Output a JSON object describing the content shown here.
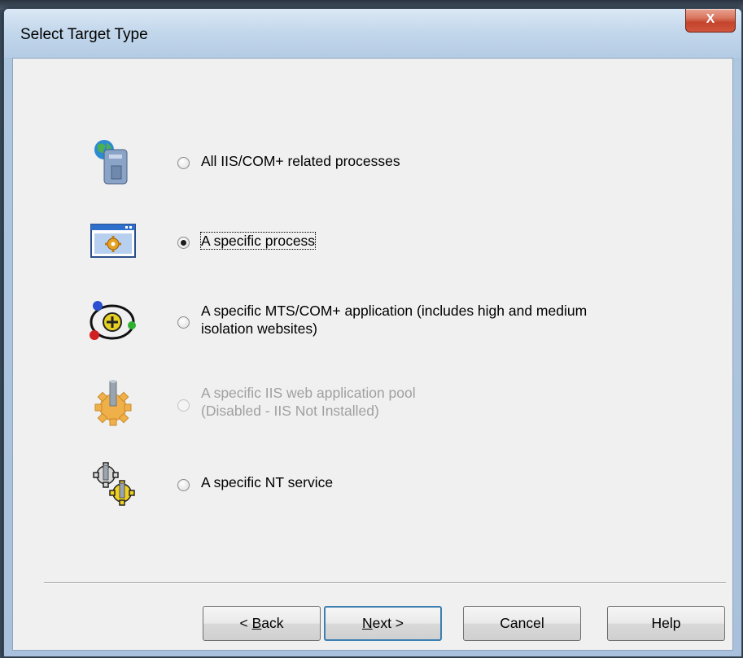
{
  "window": {
    "title": "Select Target Type",
    "close_glyph": "X"
  },
  "options": [
    {
      "label_line1": "All IIS/COM+ related processes",
      "label_line2": "",
      "icon": "iis-server-icon",
      "selected": false,
      "enabled": true
    },
    {
      "label_line1": "A specific process",
      "label_line2": "",
      "icon": "process-window-icon",
      "selected": true,
      "enabled": true
    },
    {
      "label_line1": "A specific MTS/COM+ application (includes high and medium",
      "label_line2": "isolation websites)",
      "icon": "com-atom-icon",
      "selected": false,
      "enabled": true
    },
    {
      "label_line1": "A specific IIS web application pool",
      "label_line2": "(Disabled - IIS Not Installed)",
      "icon": "app-pool-gear-icon",
      "selected": false,
      "enabled": false
    },
    {
      "label_line1": "A specific NT service",
      "label_line2": "",
      "icon": "nt-service-gears-icon",
      "selected": false,
      "enabled": true
    }
  ],
  "buttons": {
    "back": {
      "prefix": "< ",
      "mnemonic": "B",
      "rest": "ack"
    },
    "next": {
      "mnemonic": "N",
      "rest": "ext >"
    },
    "cancel": "Cancel",
    "help": "Help"
  },
  "colors": {
    "accent": "#3c7fb1",
    "disabled_text": "#a0a0a0",
    "close_button": "#c4432b"
  }
}
